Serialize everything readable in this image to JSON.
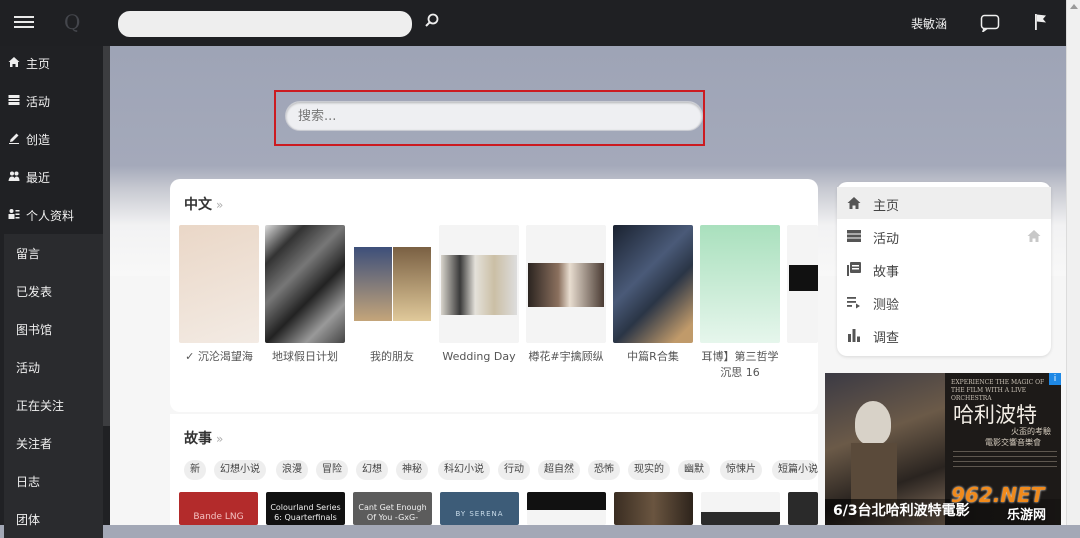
{
  "topbar": {
    "logo": "Q",
    "search_value": "",
    "username": "裴敏涵",
    "icons": [
      "menu-icon",
      "search-icon",
      "message-icon",
      "flag-icon"
    ]
  },
  "sidebar": {
    "items": [
      {
        "label": "主页",
        "icon": "home-icon"
      },
      {
        "label": "活动",
        "icon": "activity-icon"
      },
      {
        "label": "创造",
        "icon": "pencil-icon"
      },
      {
        "label": "最近",
        "icon": "people-icon"
      },
      {
        "label": "个人资料",
        "icon": "profile-icon"
      }
    ],
    "sub_items": [
      "留言",
      "已发表",
      "图书馆",
      "活动",
      "正在关注",
      "关注者",
      "日志",
      "团体"
    ]
  },
  "hero": {
    "search_placeholder": "搜索..."
  },
  "section_chinese": {
    "title": "中文",
    "more": "»",
    "books": [
      {
        "title": "✓ 沉沦渴望海",
        "color": "#e8d6c8"
      },
      {
        "title": "地球假日计划",
        "color": "#3a3a3a"
      },
      {
        "title": "我的朋友",
        "color": "#c9b27a"
      },
      {
        "title": "Wedding Day",
        "color": "#bdb7aa"
      },
      {
        "title": "樽花#宇擒顾纵",
        "color": "#5a4a40"
      },
      {
        "title": "中篇R合集",
        "color": "#2a3546"
      },
      {
        "title": "耳博】第三哲学沉思 16",
        "color": "#b7e3c5"
      },
      {
        "title": "",
        "color": "#1a1a1a"
      }
    ]
  },
  "section_story": {
    "title": "故事",
    "more": "»",
    "tags": [
      "新",
      "幻想小说",
      "浪漫",
      "冒险",
      "幻想",
      "神秘",
      "科幻小说",
      "行动",
      "超自然",
      "恐怖",
      "现实的",
      "幽默",
      "惊悚片",
      "短篇小说"
    ],
    "covers": [
      {
        "text": "Bande LNG",
        "color": "#b32b2b"
      },
      {
        "text": "Colourland Series 6: Quarterfinals",
        "color": "#111111"
      },
      {
        "text": "Cant Get Enough Of You -GxG-",
        "color": "#5c5c5c"
      },
      {
        "text": "BY SERENA",
        "color": "#3d5c78"
      },
      {
        "text": "",
        "color": "#1e1e1e"
      },
      {
        "text": "",
        "color": "#4a3b2e"
      },
      {
        "text": "",
        "color": "#2b2b2b"
      },
      {
        "text": "",
        "color": "#2a2a2a"
      }
    ]
  },
  "right_panel": {
    "items": [
      {
        "label": "主页",
        "icon": "home-icon"
      },
      {
        "label": "活动",
        "icon": "activity-icon"
      },
      {
        "label": "故事",
        "icon": "library-icon"
      },
      {
        "label": "测验",
        "icon": "quiz-icon"
      },
      {
        "label": "调查",
        "icon": "poll-icon"
      }
    ]
  },
  "ad": {
    "headline": "哈利波特",
    "subhead": "火盃的考驗",
    "line_en": "EXPERIENCE THE MAGIC OF THE FILM WITH A LIVE ORCHESTRA",
    "concert": "電影交響音樂會",
    "footer": "6/3台北哈利波特電影",
    "watermark": "962.NET",
    "watermark_cn": "乐游网",
    "ad_badge": "i"
  },
  "colors": {
    "topbar": "#1f2023",
    "sidebar": "#202124",
    "highlight_border": "#cc1b20",
    "hero": "#a3a8b6"
  }
}
